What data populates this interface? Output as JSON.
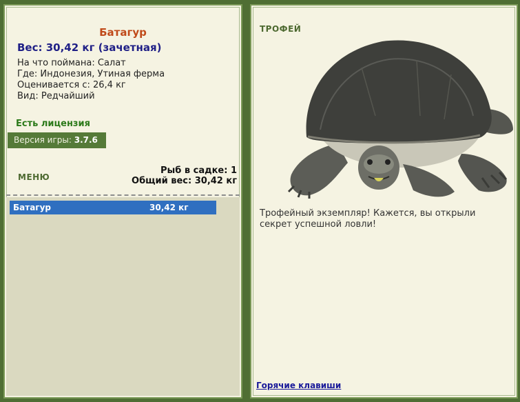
{
  "fish": {
    "name": "Батагур",
    "weight_line": "Вес: 30,42 кг (зачетная)",
    "bait_line": "На что поймана: Салат",
    "where_line": "Где: Индонезия, Утиная ферма",
    "valued_line": "Оценивается с: 26,4 кг",
    "kind_line": "Вид: Редчайший"
  },
  "license": "Есть лицензия",
  "version": {
    "label": "Версия игры:",
    "value": "3.7.6"
  },
  "menu_label": "МЕНЮ",
  "stats": {
    "fish_in_cage": "Рыб в садке: 1",
    "total_weight": "Общий вес: 30,42 кг"
  },
  "cage_list": [
    {
      "name": "Батагур",
      "weight": "30,42 кг"
    }
  ],
  "trophy": {
    "label": "ТРОФЕЙ",
    "text": "Трофейный экземпляр! Кажется, вы открыли секрет успешной ловли!",
    "image": "turtle"
  },
  "hotkeys_link": "Горячие клавиши",
  "colors": {
    "background": "#4f6e34",
    "panel": "#f5f3e2",
    "list_bg": "#dad9c0",
    "selection": "#2f6fc0",
    "fish_name": "#c04a1a",
    "weight": "#1f1f86",
    "license": "#2c7a1a"
  }
}
